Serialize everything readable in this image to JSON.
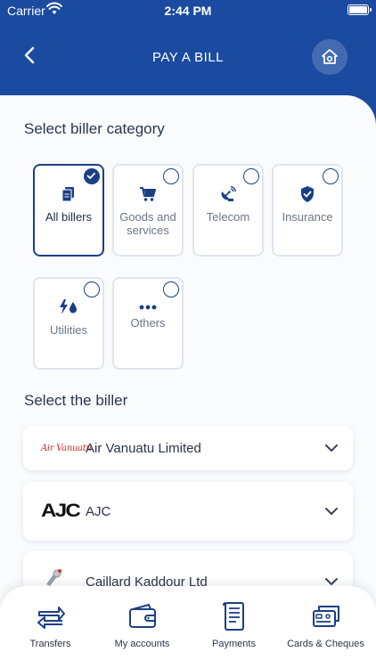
{
  "status_bar": {
    "carrier": "Carrier",
    "time": "2:44 PM"
  },
  "header": {
    "title": "PAY A BILL"
  },
  "categories_section": {
    "label": "Select biller category",
    "items": [
      {
        "label": "All billers",
        "selected": true,
        "icon": "document-icon"
      },
      {
        "label": "Goods and services",
        "selected": false,
        "icon": "cart-icon"
      },
      {
        "label": "Telecom",
        "selected": false,
        "icon": "satellite-icon"
      },
      {
        "label": "Insurance",
        "selected": false,
        "icon": "shield-check-icon"
      },
      {
        "label": "Utilities",
        "selected": false,
        "icon": "utilities-icon"
      },
      {
        "label": "Others",
        "selected": false,
        "icon": "more-dots-icon"
      }
    ]
  },
  "billers_section": {
    "label": "Select the biller",
    "items": [
      {
        "name": "Air Vanuatu Limited",
        "logo_text": "Air Vanuatu"
      },
      {
        "name": "AJC",
        "logo_text": "AJC"
      },
      {
        "name": "Caillard Kaddour Ltd"
      }
    ]
  },
  "tab_bar": {
    "items": [
      {
        "label": "Transfers",
        "icon": "transfer-arrows-icon"
      },
      {
        "label": "My accounts",
        "icon": "wallet-icon"
      },
      {
        "label": "Payments",
        "icon": "receipt-icon"
      },
      {
        "label": "Cards & Cheques",
        "icon": "cards-icon"
      }
    ]
  },
  "colors": {
    "brand_blue": "#1b4aa1",
    "accent_navy": "#1b3f86",
    "panel_bg": "#fafbfd",
    "air_vanuatu_red": "#d42a2a"
  }
}
